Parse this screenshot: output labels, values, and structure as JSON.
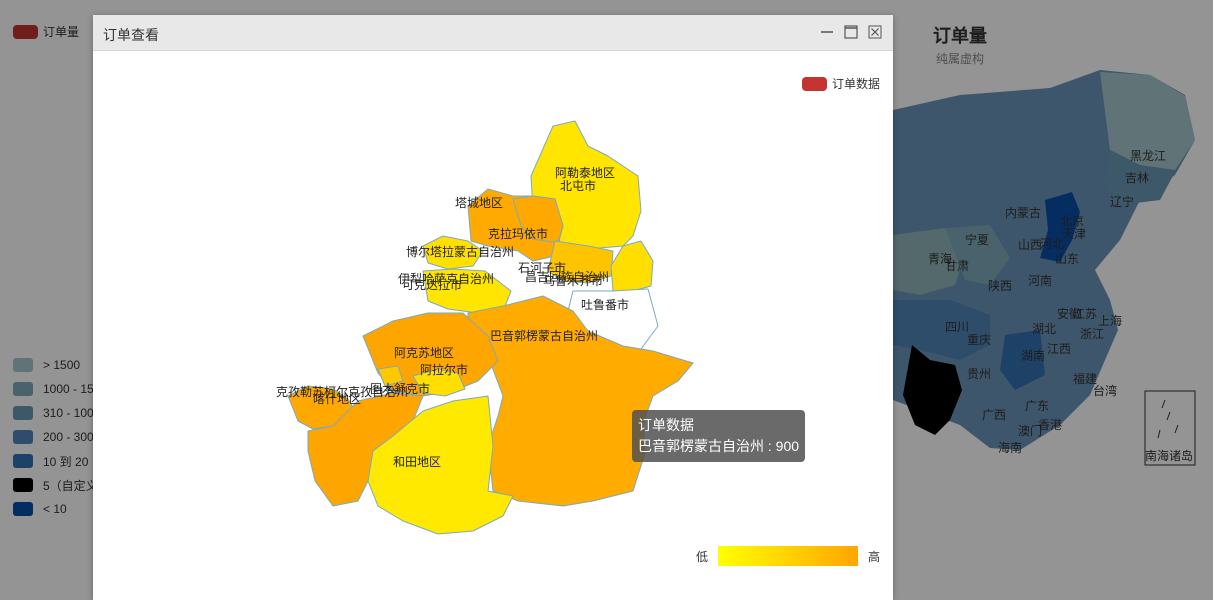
{
  "background": {
    "legend_label": "订单量",
    "legend_color": "#c23531",
    "china_title": "订单量",
    "china_subtitle": "纯属虚构",
    "ranges": [
      {
        "label": "> 1500",
        "color": "#a6c9cf"
      },
      {
        "label": "1000 - 15",
        "color": "#7fa9b9"
      },
      {
        "label": "310 - 100",
        "color": "#6a98b3"
      },
      {
        "label": "200 - 300",
        "color": "#4f86b7"
      },
      {
        "label": "10 到 20",
        "color": "#3572b1"
      },
      {
        "label": "5（自定义",
        "color": "#000000"
      },
      {
        "label": "< 10",
        "color": "#0a4fa8"
      }
    ],
    "provinces": [
      "黑龙江",
      "吉林",
      "辽宁",
      "内蒙古",
      "北京",
      "天津",
      "河北",
      "宁夏",
      "甘肃",
      "青海",
      "山西",
      "山东",
      "陕西",
      "河南",
      "四川",
      "湖北",
      "安徽",
      "江苏",
      "上海",
      "重庆",
      "湖南",
      "江西",
      "浙江",
      "贵州",
      "福建",
      "台湾",
      "广西",
      "广东",
      "香港",
      "澳门",
      "海南",
      "南海诸岛"
    ]
  },
  "modal": {
    "title": "订单查看",
    "series_legend_label": "订单数据",
    "series_color": "#c23531",
    "tooltip": {
      "series": "订单数据",
      "region": "巴音郭楞蒙古自治州",
      "value": "900"
    },
    "scale": {
      "low": "低",
      "high": "高"
    }
  },
  "chart_data": {
    "type": "map",
    "series": [
      {
        "name": "订单数据",
        "values": [
          {
            "region": "巴音郭楞蒙古自治州",
            "value": 900
          }
        ]
      }
    ],
    "labels": [
      "阿勒泰地区",
      "北屯市",
      "塔城地区",
      "克拉玛依市",
      "博尔塔拉蒙古自治州",
      "伊犁哈萨克自治州",
      "可克达拉市",
      "石河子市",
      "昌吉回族自治州",
      "乌鲁木齐市",
      "吐鲁番市",
      "巴音郭楞蒙古自治州",
      "阿克苏地区",
      "阿拉尔市",
      "克孜勒苏柯尔克孜自治州",
      "喀什地区",
      "图木舒克市",
      "和田地区"
    ],
    "visual_map": {
      "low": "低",
      "high": "高",
      "colors": [
        "#ffff00",
        "#ffa500"
      ]
    }
  }
}
